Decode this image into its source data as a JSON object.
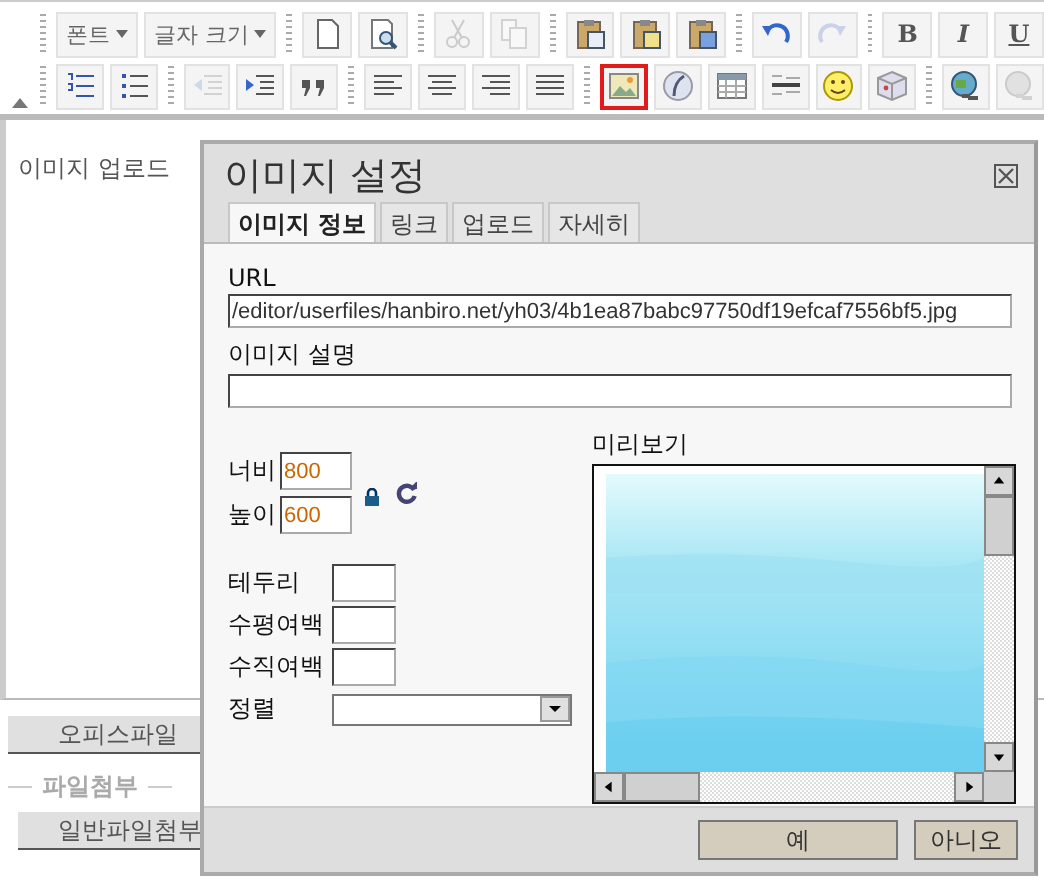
{
  "toolbar": {
    "rows": [
      [
        {
          "kind": "dropdown",
          "label": "폰트"
        },
        {
          "kind": "dropdown",
          "label": "글자 크기"
        },
        {
          "kind": "separator"
        },
        {
          "kind": "button",
          "disabled": false,
          "highlighted": false
        },
        {
          "kind": "button",
          "disabled": false,
          "highlighted": false
        },
        {
          "kind": "separator"
        },
        {
          "kind": "button",
          "disabled": true,
          "highlighted": false
        },
        {
          "kind": "button",
          "disabled": true,
          "highlighted": false
        },
        {
          "kind": "separator"
        },
        {
          "kind": "button",
          "disabled": false,
          "highlighted": false
        },
        {
          "kind": "button",
          "disabled": false,
          "highlighted": false
        },
        {
          "kind": "button",
          "disabled": false,
          "highlighted": false
        },
        {
          "kind": "separator"
        },
        {
          "kind": "button",
          "disabled": false,
          "highlighted": false
        },
        {
          "kind": "button",
          "disabled": true,
          "highlighted": false
        },
        {
          "kind": "separator"
        },
        {
          "kind": "letter",
          "label": "B"
        },
        {
          "kind": "letter",
          "label": "I"
        },
        {
          "kind": "letter",
          "label": "U"
        }
      ],
      [
        {
          "kind": "button",
          "disabled": false,
          "highlighted": false
        },
        {
          "kind": "button",
          "disabled": false,
          "highlighted": false
        },
        {
          "kind": "separator"
        },
        {
          "kind": "button",
          "disabled": true,
          "highlighted": false
        },
        {
          "kind": "button",
          "disabled": false,
          "highlighted": false
        },
        {
          "kind": "button",
          "disabled": false,
          "highlighted": false
        },
        {
          "kind": "separator"
        },
        {
          "kind": "button",
          "disabled": false,
          "highlighted": false
        },
        {
          "kind": "button",
          "disabled": false,
          "highlighted": false
        },
        {
          "kind": "button",
          "disabled": false,
          "highlighted": false
        },
        {
          "kind": "button",
          "disabled": false,
          "highlighted": false
        },
        {
          "kind": "separator"
        },
        {
          "kind": "button",
          "disabled": false,
          "highlighted": true
        },
        {
          "kind": "button",
          "disabled": false,
          "highlighted": false
        },
        {
          "kind": "button",
          "disabled": false,
          "highlighted": false
        },
        {
          "kind": "button",
          "disabled": false,
          "highlighted": false
        },
        {
          "kind": "button",
          "disabled": false,
          "highlighted": false
        },
        {
          "kind": "button",
          "disabled": false,
          "highlighted": false
        },
        {
          "kind": "separator"
        },
        {
          "kind": "button",
          "disabled": false,
          "highlighted": false
        },
        {
          "kind": "button",
          "disabled": true,
          "highlighted": false
        }
      ]
    ]
  },
  "editor": {
    "section_label": "이미지 업로드"
  },
  "attachments": {
    "office_button": "오피스파일",
    "group_legend": "파일첨부",
    "general_button": "일반파일첨부"
  },
  "dialog": {
    "title": "이미지 설정",
    "tabs": [
      {
        "label": "이미지 정보",
        "selected": true
      },
      {
        "label": "링크",
        "selected": false
      },
      {
        "label": "업로드",
        "selected": false
      },
      {
        "label": "자세히",
        "selected": false
      }
    ],
    "url_label": "URL",
    "url_value": "/editor/userfiles/hanbiro.net/yh03/4b1ea87babc97750df19efcaf7556bf5.jpg",
    "description_label": "이미지 설명",
    "width_label": "너비",
    "width_value": "800",
    "height_label": "높이",
    "height_value": "600",
    "fields": [
      {
        "label": "테두리",
        "kind": "text"
      },
      {
        "label": "수평여백",
        "kind": "text"
      },
      {
        "label": "수직여백",
        "kind": "text"
      },
      {
        "label": "정렬",
        "kind": "select"
      }
    ],
    "preview_label": "미리보기",
    "buttons": [
      "예",
      "아니오"
    ]
  }
}
